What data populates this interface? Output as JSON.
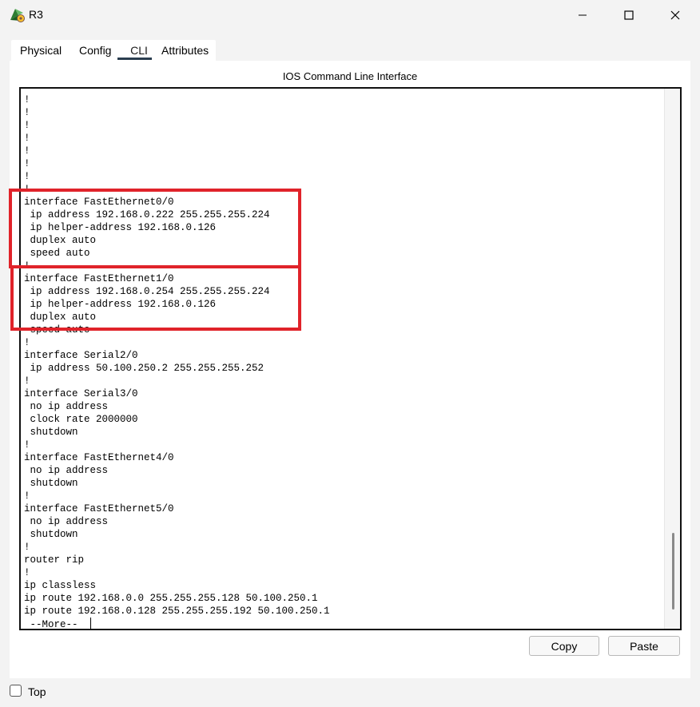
{
  "window": {
    "title": "R3"
  },
  "tabs": [
    {
      "label": "Physical"
    },
    {
      "label": "Config"
    },
    {
      "label": "CLI"
    },
    {
      "label": "Attributes"
    }
  ],
  "active_tab": "CLI",
  "panel": {
    "title": "IOS Command Line Interface"
  },
  "terminal": {
    "lines": [
      "!",
      "!",
      "!",
      "!",
      "!",
      "!",
      "!",
      "!",
      "interface FastEthernet0/0",
      " ip address 192.168.0.222 255.255.255.224",
      " ip helper-address 192.168.0.126",
      " duplex auto",
      " speed auto",
      "!",
      "interface FastEthernet1/0",
      " ip address 192.168.0.254 255.255.255.224",
      " ip helper-address 192.168.0.126",
      " duplex auto",
      " speed auto",
      "!",
      "interface Serial2/0",
      " ip address 50.100.250.2 255.255.255.252",
      "!",
      "interface Serial3/0",
      " no ip address",
      " clock rate 2000000",
      " shutdown",
      "!",
      "interface FastEthernet4/0",
      " no ip address",
      " shutdown",
      "!",
      "interface FastEthernet5/0",
      " no ip address",
      " shutdown",
      "!",
      "router rip",
      "!",
      "ip classless",
      "ip route 192.168.0.0 255.255.255.128 50.100.250.1",
      "ip route 192.168.0.128 255.255.255.192 50.100.250.1",
      " --More-- "
    ]
  },
  "buttons": {
    "copy": "Copy",
    "paste": "Paste"
  },
  "footer": {
    "top_label": "Top",
    "top_checked": false
  },
  "colors": {
    "highlight": "#e0232a",
    "tab_underline": "#2b3d4f"
  }
}
